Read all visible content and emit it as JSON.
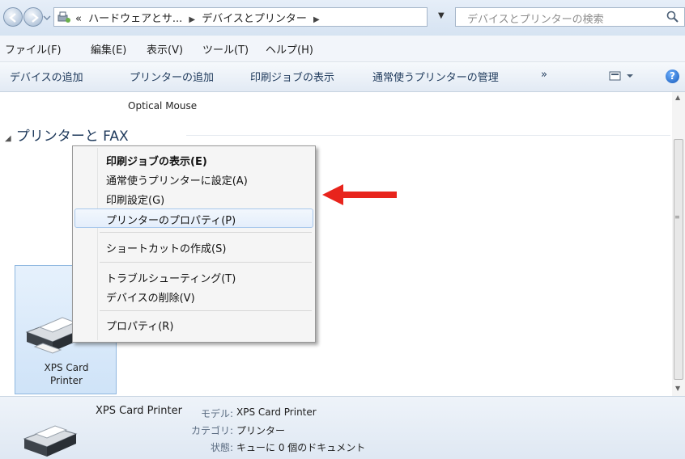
{
  "address_bar": {
    "breadcrumbs": [
      "«",
      "ハードウェアとサ...",
      "デバイスとプリンター"
    ],
    "search_placeholder": "デバイスとプリンターの検索"
  },
  "menu": [
    "ファイル(F)",
    "編集(E)",
    "表示(V)",
    "ツール(T)",
    "ヘルプ(H)"
  ],
  "commands": [
    "デバイスの追加",
    "プリンターの追加",
    "印刷ジョブの表示",
    "通常使うプリンターの管理",
    "»"
  ],
  "content": {
    "device_above": "Optical Mouse",
    "group_title": "プリンターと FAX",
    "printer_tile": {
      "line1": "XPS Card",
      "line2": "Printer"
    }
  },
  "context_menu": {
    "items": [
      {
        "label": "印刷ジョブの表示(E)",
        "bold": true
      },
      {
        "label": "通常使うプリンターに設定(A)"
      },
      {
        "label": "印刷設定(G)"
      },
      {
        "label": "プリンターのプロパティ(P)",
        "highlighted": true
      },
      {
        "label": "ショートカットの作成(S)"
      },
      {
        "label": "トラブルシューティング(T)"
      },
      {
        "label": "デバイスの削除(V)"
      },
      {
        "label": "プロパティ(R)"
      }
    ]
  },
  "details": {
    "name": "XPS Card Printer",
    "model_label": "モデル:",
    "model_value": "XPS Card Printer",
    "category_label": "カテゴリ:",
    "category_value": "プリンター",
    "status_label": "状態:",
    "status_value": "キューに 0 個のドキュメント"
  },
  "colors": {
    "accent_arrow": "#e8241c",
    "selection_border": "#a8c8ec",
    "command_text": "#1e395b"
  }
}
